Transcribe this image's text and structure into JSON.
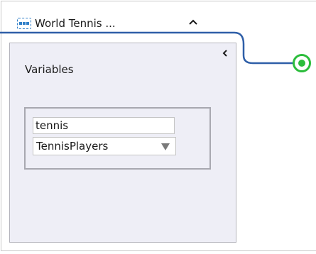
{
  "activity": {
    "title": "World Tennis ...",
    "icon": "sequence-icon",
    "collapse_icon": "chevron-up-icon"
  },
  "variables_panel": {
    "title": "Variables",
    "collapse_icon": "chevron-left-icon",
    "variable": {
      "name": "tennis",
      "type": "TennisPlayers"
    }
  },
  "end_node": {
    "icon": "end-node-icon"
  },
  "colors": {
    "connector": "#2f5fa8",
    "end_node": "#2cbd3c",
    "activity_icon": "#2f7fc8",
    "panel_bg": "#eeeef6"
  }
}
